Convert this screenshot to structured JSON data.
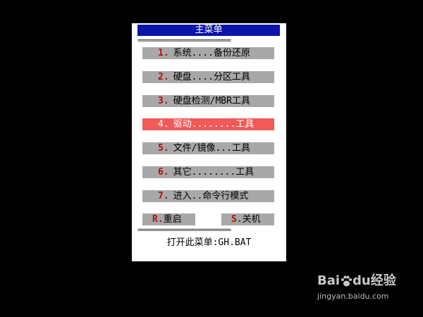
{
  "menu": {
    "title": "主菜单",
    "separator": "================================",
    "items": [
      {
        "num": "1.",
        "label": "系统....备份还原",
        "selected": false
      },
      {
        "num": "2.",
        "label": "硬盘....分区工具",
        "selected": false
      },
      {
        "num": "3.",
        "label": "硬盘检测/MBR工具",
        "selected": false
      },
      {
        "num": "4.",
        "label": "驱动........工具",
        "selected": true
      },
      {
        "num": "5.",
        "label": "文件/镜像...工具",
        "selected": false
      },
      {
        "num": "6.",
        "label": "其它........工具",
        "selected": false
      },
      {
        "num": "7.",
        "label": "进入..命令行模式",
        "selected": false
      }
    ],
    "restart": {
      "key": "R.",
      "label": "重启"
    },
    "shutdown": {
      "key": "S.",
      "label": "关机"
    },
    "footer": "打开此菜单:GH.BAT"
  },
  "watermark": {
    "brand_left": "Bai",
    "brand_right": "du",
    "brand_cn": "经验",
    "url": "jingyan.baidu.com"
  },
  "colors": {
    "background": "#000000",
    "panel": "#ffffff",
    "title_bar": "#0a14a8",
    "item": "#a8a8a8",
    "selected_item": "#f25959",
    "number": "#b01010"
  }
}
